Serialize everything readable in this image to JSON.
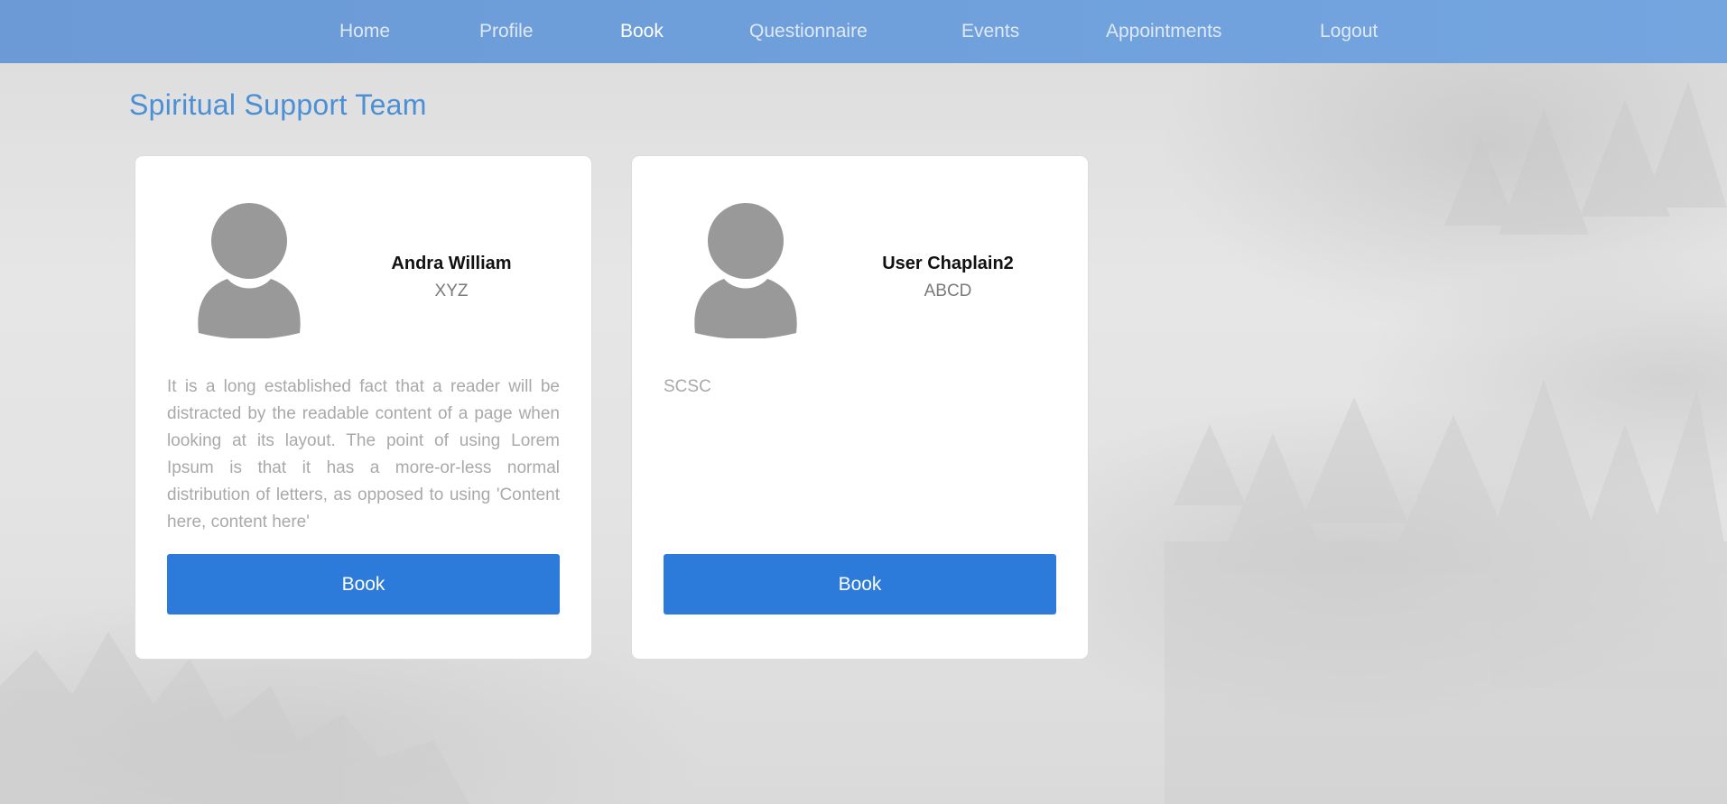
{
  "nav": {
    "items": [
      {
        "label": "Home",
        "active": false
      },
      {
        "label": "Profile",
        "active": false
      },
      {
        "label": "Book",
        "active": true
      },
      {
        "label": "Questionnaire",
        "active": false
      },
      {
        "label": "Events",
        "active": false
      },
      {
        "label": "Appointments",
        "active": false
      },
      {
        "label": "Logout",
        "active": false
      }
    ]
  },
  "page": {
    "title": "Spiritual Support Team"
  },
  "team": [
    {
      "avatar_icon": "user-silhouette-icon",
      "name": "Andra William",
      "role": "XYZ",
      "bio": "It is a long established fact that a reader will be distracted by the readable content of a page when looking at its layout. The point of using Lorem Ipsum is that it has a more-or-less normal distribution of letters, as opposed to using 'Content here, content here'",
      "button_label": "Book"
    },
    {
      "avatar_icon": "user-silhouette-icon",
      "name": "User Chaplain2",
      "role": "ABCD",
      "bio": "SCSC",
      "button_label": "Book"
    }
  ],
  "colors": {
    "navbar": "#6fa0dc",
    "title": "#4b8fd6",
    "button": "#2c7ad9",
    "avatar": "#999999"
  }
}
